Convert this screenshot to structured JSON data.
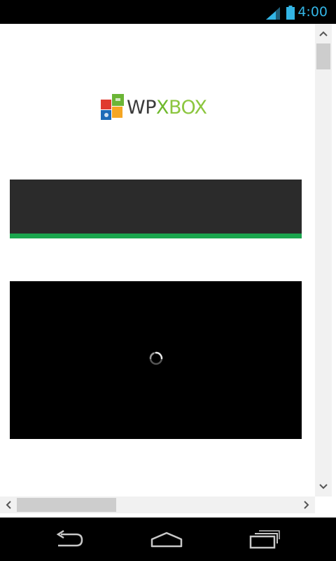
{
  "status_bar": {
    "time": "4:00",
    "icons": [
      "signal-icon",
      "battery-icon"
    ],
    "accent_color": "#33b5e5"
  },
  "page": {
    "logo": {
      "text_wp": "WP",
      "text_x": "X",
      "text_box": "BOX",
      "icon": "wpxbox-logo-icon"
    },
    "banner": {
      "color": "#2b2b2b",
      "stripe_color": "#1ba64e"
    },
    "video": {
      "state": "loading",
      "icon": "loading-spinner-icon"
    }
  },
  "scrollbars": {
    "vertical": {
      "icons": [
        "chevron-up-icon",
        "chevron-down-icon"
      ]
    },
    "horizontal": {
      "icons": [
        "chevron-left-icon",
        "chevron-right-icon"
      ]
    }
  },
  "nav_bar": {
    "buttons": [
      "back-icon",
      "home-icon",
      "recent-apps-icon"
    ]
  }
}
